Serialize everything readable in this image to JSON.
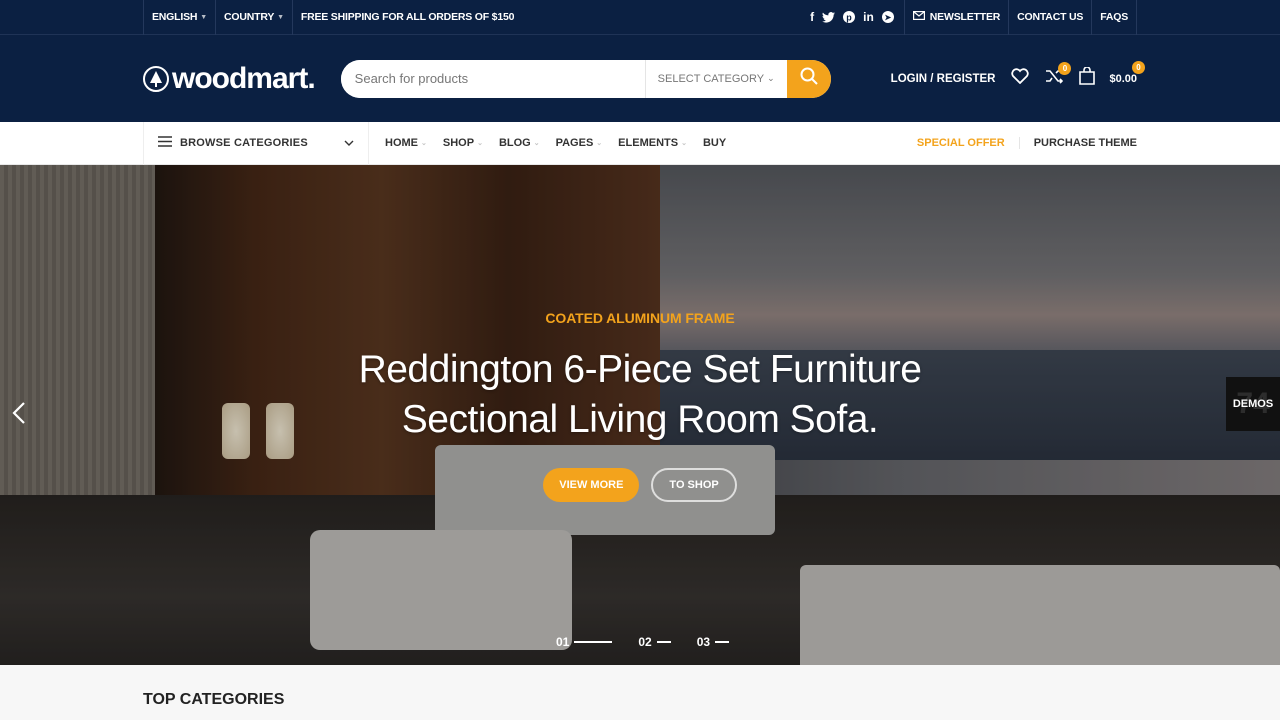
{
  "topbar": {
    "language": "ENGLISH",
    "country": "COUNTRY",
    "shipping_notice": "FREE SHIPPING FOR ALL ORDERS OF $150",
    "social_icons": [
      "facebook-icon",
      "twitter-icon",
      "pinterest-icon",
      "linkedin-icon",
      "telegram-icon"
    ],
    "newsletter": "NEWSLETTER",
    "contact": "CONTACT US",
    "faqs": "FAQS"
  },
  "header": {
    "logo_text": "woodmart.",
    "search_placeholder": "Search for products",
    "category_select": "SELECT CATEGORY",
    "login": "LOGIN / REGISTER",
    "compare_count": "0",
    "cart_count": "0",
    "cart_total": "$0.00"
  },
  "nav": {
    "browse": "BROWSE CATEGORIES",
    "items": [
      {
        "label": "HOME",
        "dropdown": true
      },
      {
        "label": "SHOP",
        "dropdown": true
      },
      {
        "label": "BLOG",
        "dropdown": true
      },
      {
        "label": "PAGES",
        "dropdown": true
      },
      {
        "label": "ELEMENTS",
        "dropdown": true
      },
      {
        "label": "BUY",
        "dropdown": false
      }
    ],
    "special_offer": "SPECIAL OFFER",
    "purchase_theme": "PURCHASE THEME"
  },
  "hero": {
    "eyebrow": "COATED ALUMINUM FRAME",
    "title_line1": "Reddington 6-Piece Set Furniture",
    "title_line2": "Sectional Living Room Sofa.",
    "primary_button": "VIEW MORE",
    "secondary_button": "TO SHOP",
    "slides": [
      "01",
      "02",
      "03"
    ],
    "active_slide": 0,
    "demos_label": "DEMOS",
    "demos_count": "74"
  },
  "sections": {
    "top_categories": "TOP CATEGORIES"
  },
  "colors": {
    "primary_dark": "#0b2042",
    "accent": "#f3a31c"
  }
}
